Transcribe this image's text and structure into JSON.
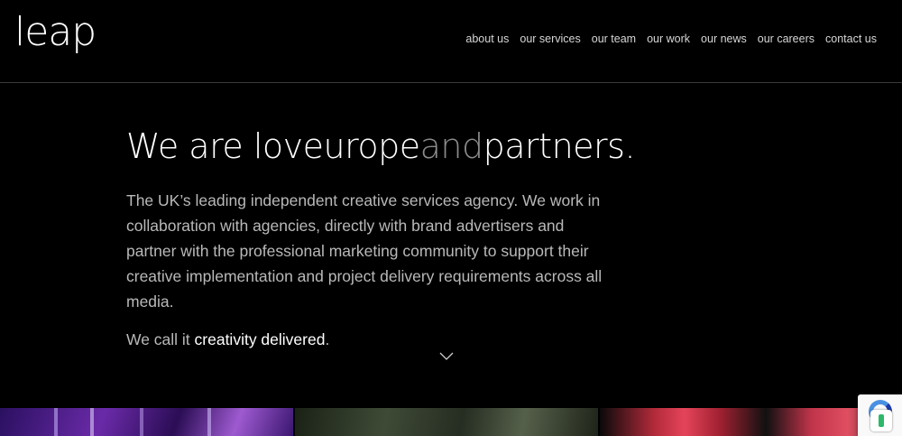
{
  "header": {
    "logo_text": "leap",
    "nav": [
      {
        "label": "about us"
      },
      {
        "label": "our services"
      },
      {
        "label": "our team"
      },
      {
        "label": "our work"
      },
      {
        "label": "our news"
      },
      {
        "label": "our careers"
      },
      {
        "label": "contact us"
      }
    ]
  },
  "hero": {
    "headline_part1": "We are loveurope",
    "headline_and": "and",
    "headline_part2": "partners.",
    "description": "The UK’s leading independent creative services agency. We work in collaboration with agencies, directly with brand advertisers and partner with the professional marketing community to support their creative implementation and project delivery requirements across all media.",
    "tagline_prefix": "We call it ",
    "tagline_bold": "creativity delivered",
    "tagline_suffix": "."
  },
  "icons": {
    "scroll_down": "chevron-down-icon",
    "recaptcha": "recaptcha-icon"
  },
  "colors": {
    "background": "#000000",
    "nav_text": "#d6d6d6",
    "body_text": "#b9b9b9",
    "muted_and": "#8c8c8c"
  }
}
